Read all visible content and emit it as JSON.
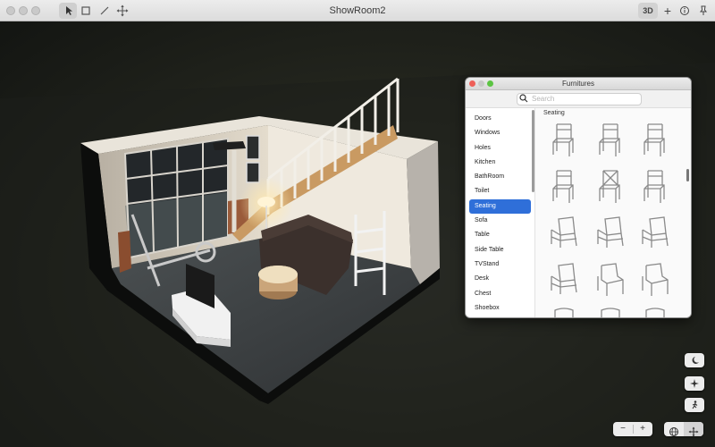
{
  "window": {
    "title": "ShowRoom2"
  },
  "toolbar": {
    "tools": [
      "select-tool",
      "rectangle-tool",
      "line-tool",
      "move-tool"
    ],
    "view_mode_label": "3D",
    "add_label": "+",
    "info_label": "ⓘ",
    "pin_label": "📌"
  },
  "panel": {
    "title": "Furnitures",
    "search_placeholder": "Search",
    "search_value": "",
    "categories": [
      "Doors",
      "Windows",
      "Holes",
      "Kitchen",
      "BathRoom",
      "Toilet",
      "Seating",
      "Sofa",
      "Table",
      "Side Table",
      "TVStand",
      "Desk",
      "Chest",
      "Shoebox"
    ],
    "selected_category": "Seating",
    "grid_heading": "Seating",
    "items": [
      "dining-chair",
      "dining-chair",
      "dining-chair",
      "dining-chair",
      "cross-back-chair",
      "dining-chair",
      "armchair",
      "armchair",
      "armchair",
      "armchair",
      "lounge-chair",
      "lounge-chair",
      "chair",
      "chair",
      "chair"
    ]
  },
  "controls": {
    "night_mode_icon": "moon-icon",
    "lighting_icon": "sparkle-icon",
    "walk_icon": "walk-icon",
    "zoom_out_label": "−",
    "zoom_in_label": "+",
    "globe_icon": "globe-icon",
    "pan_icon": "move-icon"
  },
  "colors": {
    "accent": "#2f6fd9",
    "viewport_bg": "#25271f",
    "floor": "#3e4245",
    "wall": "#d9d3c8",
    "sofa": "#3b302c"
  }
}
